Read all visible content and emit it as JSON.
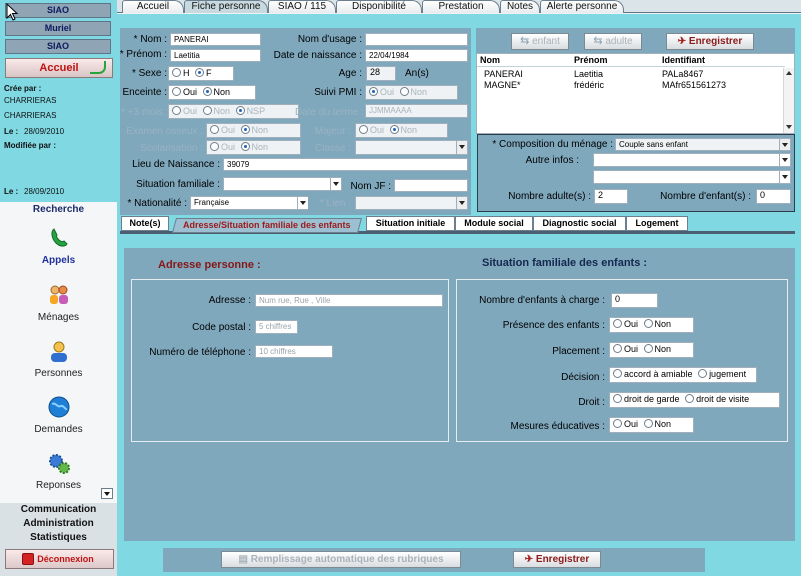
{
  "sidebar": {
    "head1": "SIAO",
    "head2": "Muriel",
    "head3": "SIAO",
    "accueil_label": "Accueil",
    "cree_par_label": "Crée par :",
    "cree_par_1": "CHARRIERAS",
    "cree_par_2": "CHARRIERAS",
    "le_label": "Le :",
    "cree_date": "28/09/2010",
    "modifiee_par_label": "Modifiée par :",
    "modifiee_date": "28/09/2010",
    "recherche_label": "Recherche",
    "nav": [
      {
        "label": "Appels",
        "icon": "phone-icon"
      },
      {
        "label": "Ménages",
        "icon": "family-icon"
      },
      {
        "label": "Personnes",
        "icon": "person-icon"
      },
      {
        "label": "Demandes",
        "icon": "globe-icon"
      },
      {
        "label": "Reponses",
        "icon": "gears-icon"
      }
    ],
    "communication_label": "Communication",
    "administration_label": "Administration",
    "statistiques_label": "Statistiques",
    "deconnexion_label": "Déconnexion"
  },
  "tabs": [
    "Accueil",
    "Fiche personne",
    "SIAO / 115",
    "Disponibilité",
    "Prestation",
    "Notes",
    "Alerte personne"
  ],
  "form": {
    "nom_label": "* Nom :",
    "nom_value": "PANERAI",
    "nom_usage_label": "Nom d'usage :",
    "prenom_label": "* Prénom :",
    "prenom_value": "Laetitia",
    "date_naissance_label": "Date de naissance :",
    "date_naissance_value": "22/04/1984",
    "sexe_label": "* Sexe :",
    "sexe_h": "H",
    "sexe_f": "F",
    "age_label": "Age :",
    "age_value": "28",
    "age_unit": "An(s)",
    "enceinte_label": "Enceinte :",
    "oui": "Oui",
    "non": "Non",
    "nsp": "NSP",
    "suivi_pmi_label": "Suivi PMI :",
    "plus3mois_label": "* +3 mois :",
    "date_terme_label": "Date du terme :",
    "date_terme_placeholder": "JJMMAAAA",
    "examen_label": "Examen osseux :",
    "majeur_label": "Majeur :",
    "scolarisation_label": "Scolarisation :",
    "classe_label": "Classe :",
    "lieu_naissance_label": "Lieu de Naissance :",
    "lieu_naissance_value": "39079",
    "situation_familiale_label": "Situation familiale :",
    "nom_jf_label": "Nom JF :",
    "nationalite_label": "* Nationalité :",
    "nationalite_value": "Française",
    "lien_label": "* Lien :"
  },
  "right": {
    "enfant_btn": "enfant",
    "adulte_btn": "adulte",
    "enregistrer_btn": "Enregistrer",
    "list_headers": [
      "Nom",
      "Prénom",
      "Identifiant"
    ],
    "list_rows": [
      [
        "PANERAI",
        "Laetitia",
        "PALa8467"
      ],
      [
        "MAGNE*",
        "frédéric",
        "MAfr651561273"
      ]
    ],
    "composition_label": "* Composition du ménage :",
    "composition_value": "Couple sans enfant",
    "autres_infos_label": "Autre infos :",
    "nb_adultes_label": "Nombre adulte(s) :",
    "nb_adultes_value": "2",
    "nb_enfants_label": "Nombre d'enfant(s) :",
    "nb_enfants_value": "0"
  },
  "subtabs": [
    "Note(s)",
    "Adresse/Situation familiale des enfants",
    "Situation initiale",
    "Module social",
    "Diagnostic social",
    "Logement"
  ],
  "adresse": {
    "title": "Adresse personne :",
    "adresse_label": "Adresse :",
    "adresse_placeholder": "Num rue, Rue , Ville",
    "cp_label": "Code postal :",
    "cp_placeholder": "5 chiffres",
    "tel_label": "Numéro de téléphone :",
    "tel_placeholder": "10 chiffres"
  },
  "enfants": {
    "title": "Situation familiale des enfants :",
    "nb_charge_label": "Nombre d'enfants à charge :",
    "nb_charge_value": "0",
    "presence_label": "Présence des enfants :",
    "placement_label": "Placement :",
    "decision_label": "Décision :",
    "accord": "accord à amiable",
    "jugement": "jugement",
    "droit_label": "Droit :",
    "droit_garde": "droit de garde",
    "droit_visite": "droit de visite",
    "mesures_label": "Mesures éducatives :"
  },
  "bottom": {
    "remplissage_btn": "Remplissage automatique des rubriques",
    "enregistrer_btn": "Enregistrer"
  }
}
